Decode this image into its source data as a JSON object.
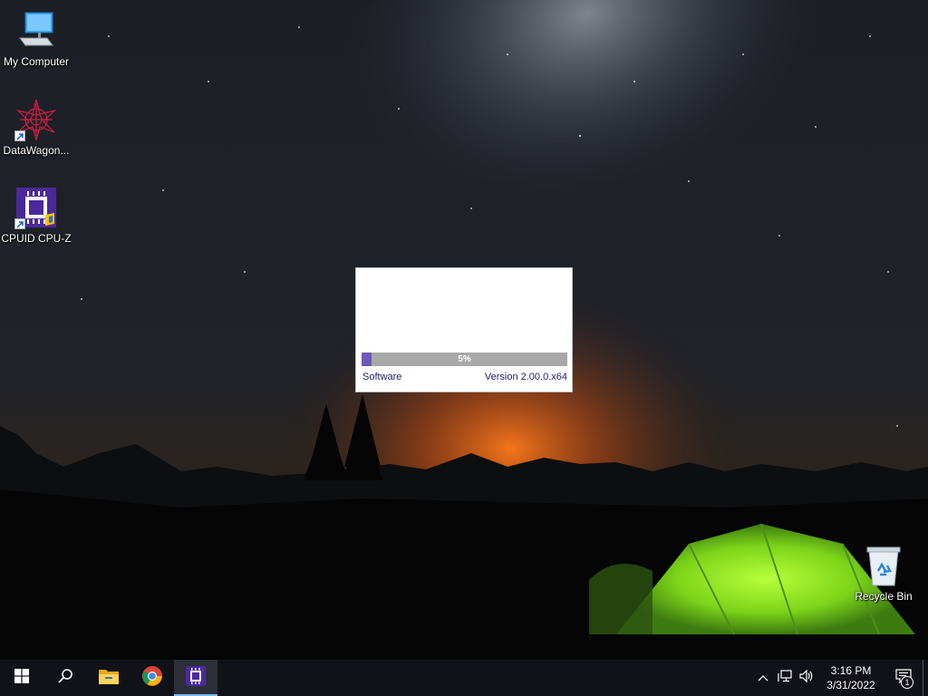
{
  "desktop": {
    "icons": [
      {
        "label": "My Computer",
        "icon": "computer-icon"
      },
      {
        "label": "DataWagon...",
        "icon": "datawagon-icon"
      },
      {
        "label": "CPUID CPU-Z",
        "icon": "cpuz-icon"
      },
      {
        "label": "Recycle Bin",
        "icon": "recycle-bin-icon"
      }
    ]
  },
  "splash": {
    "progress_text": "5%",
    "progress_fraction": 0.05,
    "left_label": "Software",
    "right_label": "Version 2.00.0.x64",
    "accent_color": "#6e5bb8"
  },
  "taskbar": {
    "apps": [
      {
        "icon": "windows-start-icon"
      },
      {
        "icon": "search-icon"
      },
      {
        "icon": "file-explorer-icon"
      },
      {
        "icon": "chrome-icon"
      },
      {
        "icon": "cpuz-icon",
        "active": true
      }
    ],
    "tray": {
      "time": "3:16 PM",
      "date": "3/31/2022",
      "notification_count": "1"
    }
  }
}
